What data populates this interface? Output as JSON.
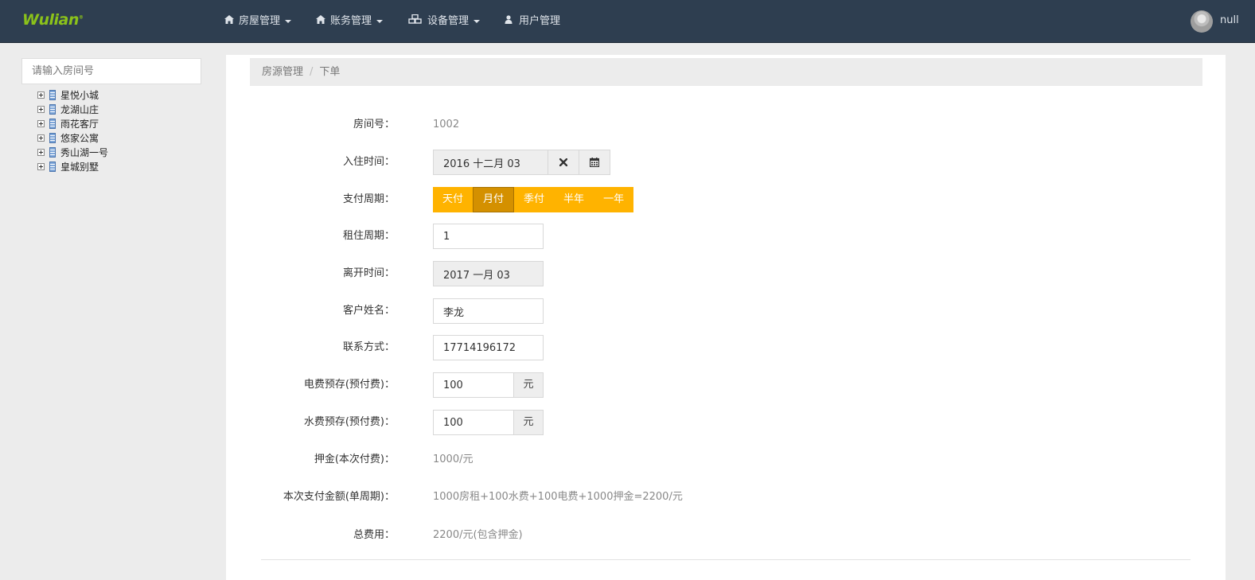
{
  "brand": {
    "logo": "Wulian",
    "trademark": "®"
  },
  "nav": {
    "items": [
      {
        "label": "房屋管理",
        "icon": "home-icon",
        "dropdown": true
      },
      {
        "label": "账务管理",
        "icon": "home-icon",
        "dropdown": true
      },
      {
        "label": "设备管理",
        "icon": "cubes-icon",
        "dropdown": true
      },
      {
        "label": "用户管理",
        "icon": "user-icon",
        "dropdown": false
      }
    ],
    "user": {
      "name": "null"
    }
  },
  "sidebar": {
    "search_placeholder": "请输入房间号",
    "tree": [
      {
        "label": "星悦小城"
      },
      {
        "label": "龙湖山庄"
      },
      {
        "label": "雨花客厅"
      },
      {
        "label": "悠家公寓"
      },
      {
        "label": "秀山湖一号"
      },
      {
        "label": "皇城别墅"
      }
    ]
  },
  "breadcrumb": {
    "parent": "房源管理",
    "separator": "/",
    "current": "下单"
  },
  "form": {
    "room": {
      "label": "房间号：",
      "value": "1002"
    },
    "checkin": {
      "label": "入住时间：",
      "value": "2016 十二月 03"
    },
    "pay_cycle": {
      "label": "支付周期：",
      "options": [
        "天付",
        "月付",
        "季付",
        "半年",
        "一年"
      ],
      "selected": "月付"
    },
    "lease": {
      "label": "租住周期：",
      "value": "1"
    },
    "checkout": {
      "label": "离开时间：",
      "value": "2017 一月 03"
    },
    "customer": {
      "label": "客户姓名：",
      "value": "李龙"
    },
    "contact": {
      "label": "联系方式：",
      "value": "17714196172"
    },
    "electric": {
      "label": "电费预存(预付费)：",
      "value": "100",
      "unit": "元"
    },
    "water": {
      "label": "水费预存(预付费)：",
      "value": "100",
      "unit": "元"
    },
    "deposit": {
      "label": "押金(本次付费)：",
      "value": "1000/元"
    },
    "payment": {
      "label": "本次支付金额(单周期)：",
      "value": "1000房租+100水费+100电费+1000押金=2200/元"
    },
    "total": {
      "label": "总费用：",
      "value": "2200/元(包含押金)"
    }
  },
  "colors": {
    "navbar": "#2e3e50",
    "logo": "#8bc21a",
    "pay_group": "#ffb300",
    "pay_active": "#d49000"
  }
}
